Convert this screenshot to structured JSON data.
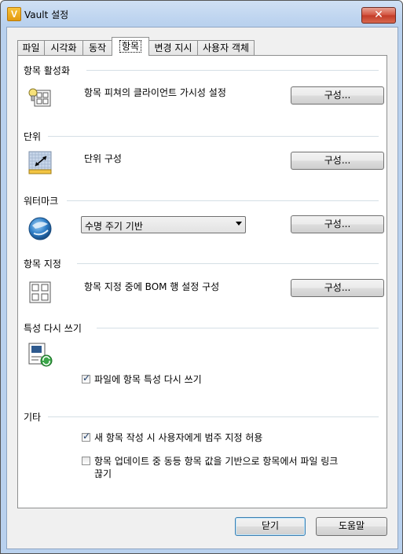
{
  "window": {
    "title": "Vault 설정",
    "app_icon_glyph": "V",
    "close_glyph": "✕"
  },
  "tabs": [
    {
      "label": "파일"
    },
    {
      "label": "시각화"
    },
    {
      "label": "동작"
    },
    {
      "label": "항목"
    },
    {
      "label": "변경 지시"
    },
    {
      "label": "사용자 객체"
    }
  ],
  "active_tab": "항목",
  "sections": {
    "item_enable": {
      "title": "항목 활성화",
      "label": "항목 피쳐의 클라이언트 가시성 설정",
      "button": "구성...",
      "icon": "lightbulb-grid-icon"
    },
    "units": {
      "title": "단위",
      "label": "단위 구성",
      "button": "구성...",
      "icon": "ruler-grid-icon"
    },
    "watermark": {
      "title": "워터마크",
      "combo_value": "수명 주기 기반",
      "button": "구성...",
      "icon": "globe-icon"
    },
    "item_assign": {
      "title": "항목 지정",
      "label": "항목 지정 중에 BOM 행 설정 구성",
      "button": "구성...",
      "icon": "grid-icon"
    },
    "property_write": {
      "title": "특성 다시 쓰기",
      "checkbox_label": "파일에 항목 특성 다시 쓰기",
      "checked": true,
      "icon": "property-refresh-icon"
    },
    "misc": {
      "title": "기타",
      "checkbox1_label": "새 항목 작성 시 사용자에게 범주 지정 허용",
      "checkbox1_checked": true,
      "checkbox2_label_line1": "항목 업데이트 중 동등 항목 값을 기반으로 항목에서 파일 링크",
      "checkbox2_label_line2": "끊기",
      "checkbox2_checked": false
    }
  },
  "footer": {
    "close_label": "닫기",
    "help_label": "도움말"
  },
  "colors": {
    "section_line": "#d5dfe5",
    "titlebar": "#b9d1ee",
    "close_button": "#c23a27"
  }
}
